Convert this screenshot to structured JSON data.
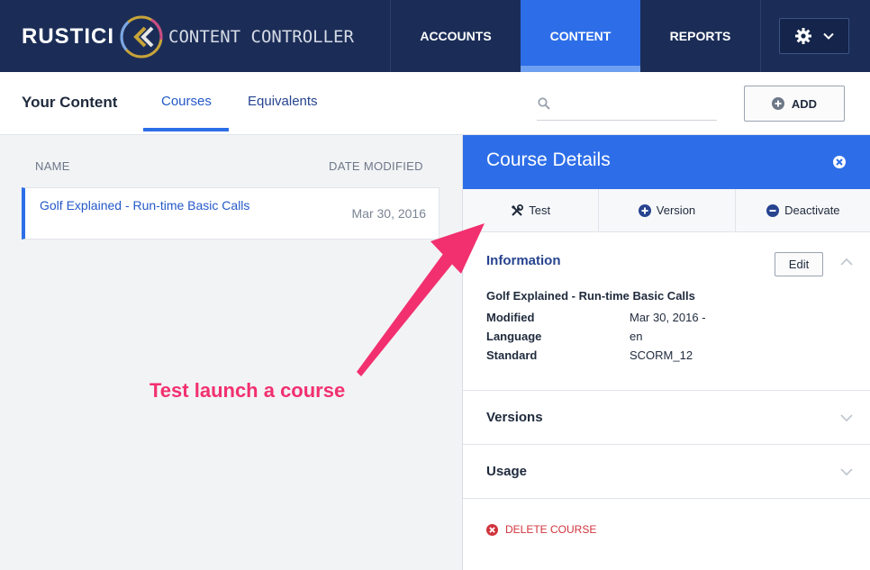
{
  "app": {
    "brand": "RUSTICI",
    "product": "CONTENT CONTROLLER"
  },
  "nav": {
    "items": [
      {
        "label": "ACCOUNTS"
      },
      {
        "label": "CONTENT"
      },
      {
        "label": "REPORTS"
      }
    ],
    "active": "CONTENT",
    "settings_icon": "gear-icon"
  },
  "subheader": {
    "title": "Your Content",
    "tabs": [
      {
        "label": "Courses"
      },
      {
        "label": "Equivalents"
      }
    ],
    "active_tab": "Courses",
    "search": {
      "placeholder": "",
      "value": ""
    },
    "add_label": "ADD"
  },
  "list": {
    "columns": [
      "NAME",
      "DATE MODIFIED"
    ],
    "rows": [
      {
        "name": "Golf Explained - Run-time Basic Calls",
        "date": "Mar 30, 2016"
      }
    ]
  },
  "panel": {
    "title": "Course Details",
    "actions": [
      {
        "label": "Test",
        "icon": "wrench-screwdriver-icon"
      },
      {
        "label": "Version",
        "icon": "plus-circle-icon"
      },
      {
        "label": "Deactivate",
        "icon": "minus-circle-icon"
      }
    ],
    "information": {
      "title": "Information",
      "edit_label": "Edit",
      "course_name": "Golf Explained - Run-time Basic Calls",
      "fields": [
        {
          "key": "Modified",
          "value": "Mar 30, 2016 -"
        },
        {
          "key": "Language",
          "value": "en"
        },
        {
          "key": "Standard",
          "value": "SCORM_12"
        }
      ]
    },
    "sections": [
      {
        "title": "Versions"
      },
      {
        "title": "Usage"
      }
    ],
    "delete_label": "DELETE COURSE"
  },
  "annotation": {
    "text": "Test launch a course"
  },
  "colors": {
    "nav_bg": "#1b2d57",
    "accent": "#2d6ee8",
    "link": "#2459c8",
    "annotation": "#f2306f",
    "danger": "#d0343c"
  }
}
